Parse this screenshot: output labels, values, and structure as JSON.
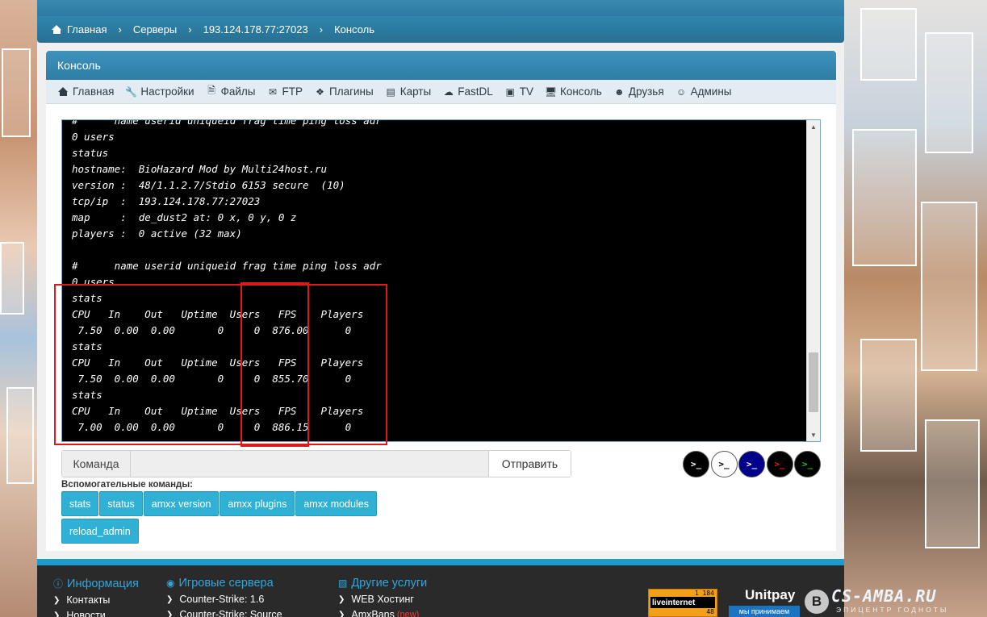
{
  "breadcrumb": [
    {
      "label": "Главная",
      "icon": "home-icon"
    },
    {
      "label": "Серверы"
    },
    {
      "label": "193.124.178.77:27023"
    },
    {
      "label": "Консоль"
    }
  ],
  "panel": {
    "title": "Консоль"
  },
  "nav": [
    {
      "label": "Главная",
      "icon": "home-icon"
    },
    {
      "label": "Настройки",
      "icon": "wrench-icon"
    },
    {
      "label": "Файлы",
      "icon": "file-icon"
    },
    {
      "label": "FTP",
      "icon": "envelope-icon"
    },
    {
      "label": "Плагины",
      "icon": "cubes-icon"
    },
    {
      "label": "Карты",
      "icon": "map-icon"
    },
    {
      "label": "FastDL",
      "icon": "cloud-download-icon"
    },
    {
      "label": "TV",
      "icon": "video-camera-icon"
    },
    {
      "label": "Консоль",
      "icon": "monitor-icon"
    },
    {
      "label": "Друзья",
      "icon": "users-icon"
    },
    {
      "label": "Админы",
      "icon": "user-shield-icon"
    }
  ],
  "console": {
    "lines": [
      "#      name userid uniqueid frag time ping loss adr",
      "0 users",
      "status",
      "hostname:  BioHazard Mod by Multi24host.ru",
      "version :  48/1.1.2.7/Stdio 6153 secure  (10)",
      "tcp/ip  :  193.124.178.77:27023",
      "map     :  de_dust2 at: 0 x, 0 y, 0 z",
      "players :  0 active (32 max)",
      "",
      "#      name userid uniqueid frag time ping loss adr",
      "0 users",
      "stats",
      "CPU   In    Out   Uptime  Users   FPS    Players",
      " 7.50  0.00  0.00       0     0  876.00      0",
      "stats",
      "CPU   In    Out   Uptime  Users   FPS    Players",
      " 7.50  0.00  0.00       0     0  855.70      0",
      "stats",
      "CPU   In    Out   Uptime  Users   FPS    Players",
      " 7.00  0.00  0.00       0     0  886.15      0"
    ]
  },
  "command": {
    "label": "Команда",
    "value": "",
    "send_label": "Отправить"
  },
  "themes": [
    {
      "glyph": ">_",
      "bg": "#000000",
      "fg": "#ffffff"
    },
    {
      "glyph": ">_",
      "bg": "#ffffff",
      "fg": "#000000"
    },
    {
      "glyph": ">_",
      "bg": "#00008b",
      "fg": "#ffffff"
    },
    {
      "glyph": ">_",
      "bg": "#000000",
      "fg": "#e02020"
    },
    {
      "glyph": ">_",
      "bg": "#000000",
      "fg": "#20c020"
    }
  ],
  "helpers": {
    "title": "Вспомогательные команды:",
    "buttons": [
      "stats",
      "status",
      "amxx version",
      "amxx plugins",
      "amxx modules",
      "reload_admin"
    ]
  },
  "footer": {
    "col1": {
      "title": "Информация",
      "items": [
        "Контакты",
        "Новости"
      ]
    },
    "col2": {
      "title": "Игровые сервера",
      "items": [
        "Counter-Strike: 1.6",
        "Counter-Strike: Source"
      ]
    },
    "col3": {
      "title": "Другие услуги",
      "items": [
        "WEB Хостинг",
        "AmxBans"
      ],
      "new_badge": "(new)"
    },
    "liveinternet": {
      "count": "1 184",
      "count2": "48",
      "label": "liveinternet"
    },
    "unitpay": {
      "name": "Unitpay",
      "sub": "мы принимаем"
    },
    "vk": "В",
    "csamba": {
      "name": "CS-AMBA.RU",
      "tagline": "ЭПИЦЕНТР ГОДНОТЫ"
    }
  },
  "colors": {
    "accent": "#2e7da4",
    "helper_btn": "#31b0d5",
    "highlight": "#e01818",
    "footer_link": "#2da7dd"
  }
}
